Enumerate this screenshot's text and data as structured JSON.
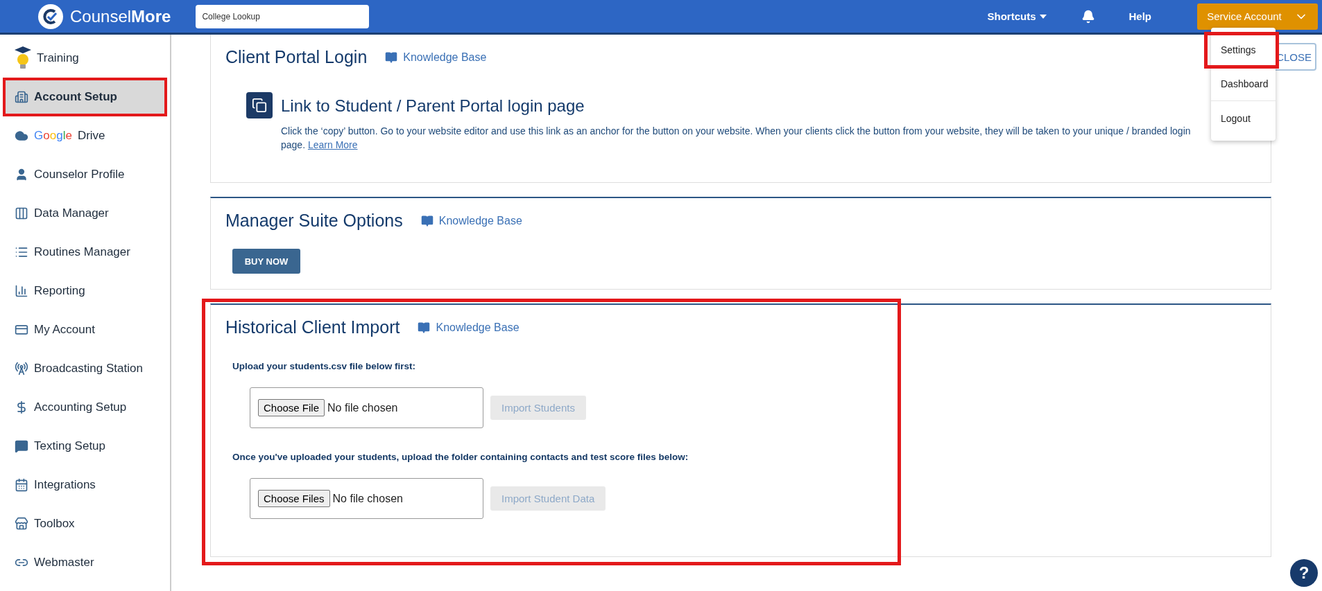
{
  "header": {
    "brand": "Counsel**More**",
    "search": {
      "placeholder": "College Lookup"
    },
    "shortcuts": "Shortcuts",
    "help": "Help",
    "account_button": "Service Account"
  },
  "account_menu": {
    "expanded": true,
    "items": [
      {
        "label": "Settings",
        "highlighted": true
      },
      {
        "label": "Dashboard",
        "highlighted": false
      },
      {
        "label": "Logout",
        "highlighted": false
      }
    ]
  },
  "sidebar": {
    "items": [
      {
        "label": "Training",
        "selected": false,
        "highlighted": false
      },
      {
        "label": "Account Setup",
        "selected": true,
        "highlighted": true
      },
      {
        "brand": "Google",
        "label": "Drive",
        "selected": false,
        "highlighted": false
      },
      {
        "label": "Counselor Profile",
        "selected": false,
        "highlighted": false
      },
      {
        "label": "Data Manager",
        "selected": false,
        "highlighted": false
      },
      {
        "label": "Routines Manager",
        "selected": false,
        "highlighted": false
      },
      {
        "label": "Reporting",
        "selected": false,
        "highlighted": false
      },
      {
        "label": "My Account",
        "selected": false,
        "highlighted": false
      },
      {
        "label": "Broadcasting Station",
        "selected": false,
        "highlighted": false
      },
      {
        "label": "Accounting Setup",
        "selected": false,
        "highlighted": false
      },
      {
        "label": "Texting Setup",
        "selected": false,
        "highlighted": false
      },
      {
        "label": "Integrations",
        "selected": false,
        "highlighted": false
      },
      {
        "label": "Toolbox",
        "selected": false,
        "highlighted": false
      },
      {
        "label": "Webmaster",
        "selected": false,
        "highlighted": false
      }
    ]
  },
  "close_button": "CLOSE",
  "sections": [
    {
      "kind": "portal",
      "title": "Client Portal Login",
      "link": "Knowledge Base",
      "highlighted": false,
      "portal_title": "Link to Student / Parent Portal login page",
      "description": "Click the ‘copy’ button. Go to your website editor and use this link as an anchor for the button on your website. When your clients click the button from your website, they will be taken to your unique / branded login page.",
      "learn_more": "Learn More"
    },
    {
      "kind": "buy",
      "title": "Manager Suite Options",
      "link": "Knowledge Base",
      "highlighted": false,
      "button": "BUY NOW"
    },
    {
      "kind": "import",
      "title": "Historical Client Import",
      "link": "Knowledge Base",
      "highlighted": true,
      "uploads": [
        {
          "label": "Upload your students.csv file below first:",
          "chooser": "Choose File",
          "status": "No file chosen",
          "action": "Import Students",
          "disabled": true
        },
        {
          "label": "Once you've uploaded your students, upload the folder containing contacts and test score files below:",
          "chooser": "Choose Files",
          "status": "No file chosen",
          "action": "Import Student Data",
          "disabled": true
        }
      ]
    }
  ],
  "help_button": "?"
}
